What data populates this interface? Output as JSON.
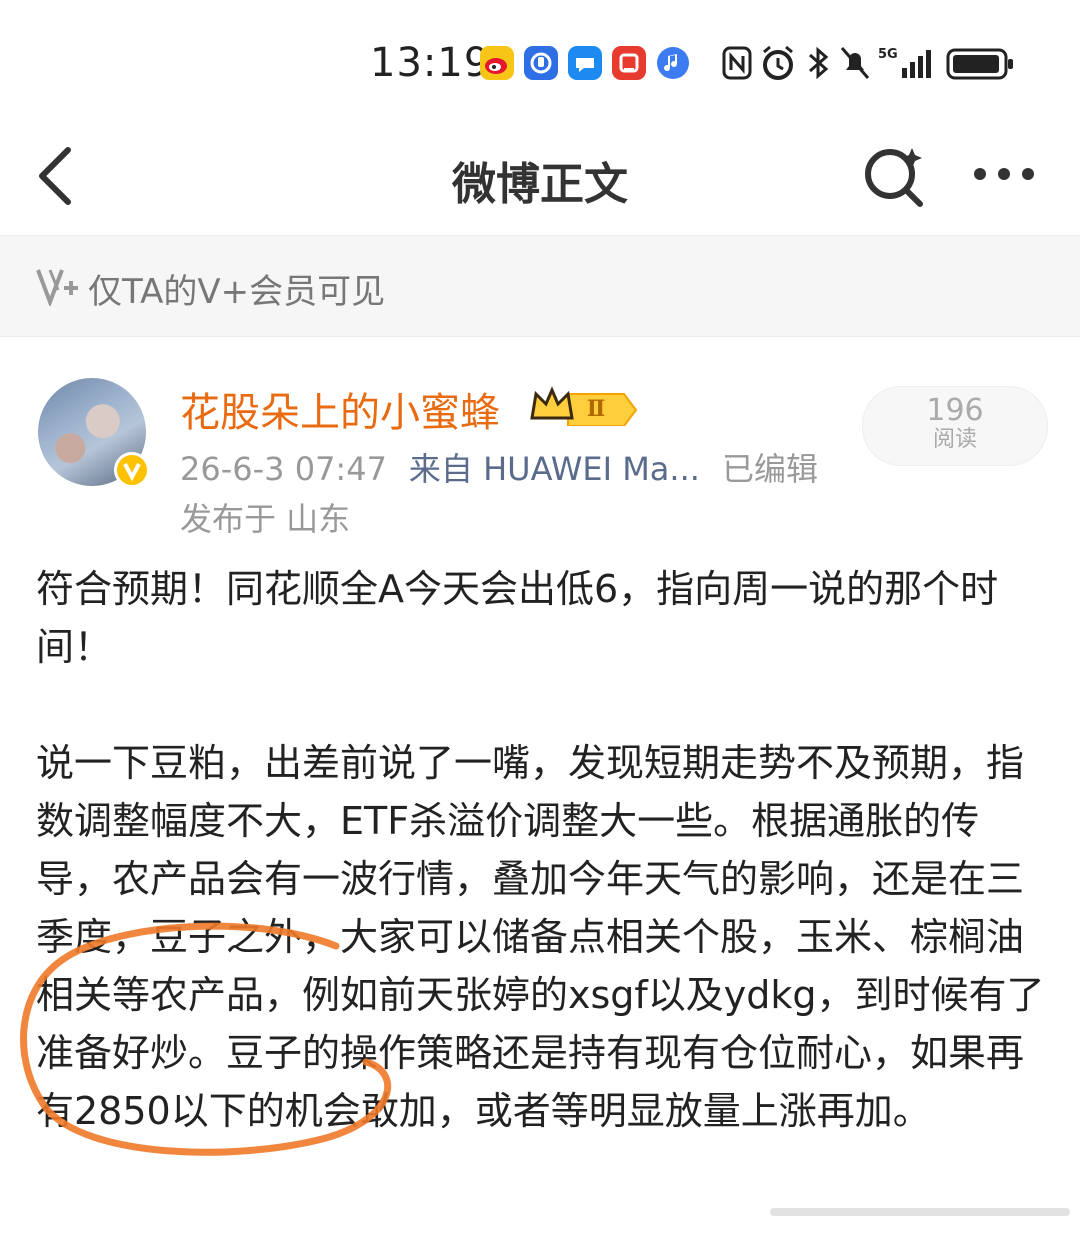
{
  "status_bar": {
    "time": "13:19",
    "network": "5G",
    "icons": [
      "weibo-app-icon",
      "blue-app-icon",
      "message-app-icon",
      "red-app-icon",
      "music-app-icon",
      "nfc-icon",
      "alarm-icon",
      "bluetooth-icon",
      "mute-icon",
      "signal-icon",
      "battery-icon"
    ]
  },
  "header": {
    "title": "微博正文",
    "icons": [
      "back-arrow-icon",
      "search-sparkle-icon",
      "more-dots-icon"
    ]
  },
  "visibility": {
    "text": "仅TA的V+会员可见"
  },
  "post": {
    "author": "花股朵上的小蜜蜂",
    "level_badge": "Ⅱ",
    "time": "26-6-3 07:47",
    "source": "来自 HUAWEI Ma...",
    "edited": "已编辑",
    "location": "发布于 山东",
    "reads": "196",
    "reads_label": "阅读",
    "paragraphs": [
      "符合预期！同花顺全A今天会出低6，指向周一说的那个时间！",
      "说一下豆粕，出差前说了一嘴，发现短期走势不及预期，指数调整幅度不大，ETF杀溢价调整大一些。根据通胀的传导，农产品会有一波行情，叠加今年天气的影响，还是在三季度，豆子之外，大家可以储备点相关个股，玉米、棕榈油相关等农产品，例如前天张婷的xsgf以及ydkg，到时候有了准备好炒。豆子的操作策略还是持有现有仓位耐心，如果再有2850以下的机会敢加，或者等明显放量上涨再加。"
    ]
  },
  "colors": {
    "author": "#e86b12",
    "annotation_circle": "#f07a2a",
    "meta": "#999999",
    "source": "#5b6b8c"
  }
}
